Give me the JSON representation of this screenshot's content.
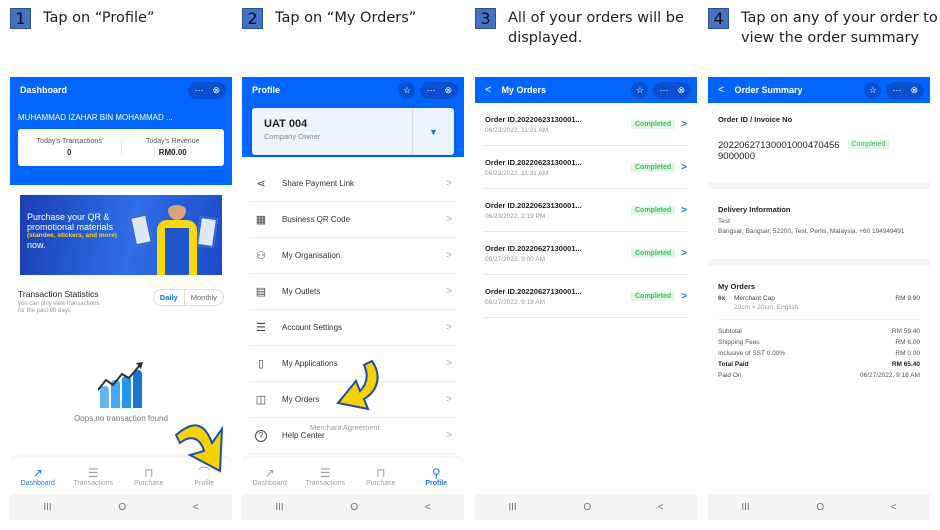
{
  "steps": [
    {
      "num": "1",
      "text": "Tap on “Profile”"
    },
    {
      "num": "2",
      "text": "Tap on “My Orders”"
    },
    {
      "num": "3",
      "text": "All of your orders will be displayed."
    },
    {
      "num": "4",
      "text": "Tap on any of your order to view the order summary"
    }
  ],
  "common": {
    "more_icon": "⋯",
    "close_icon": "⊗",
    "star_icon": "☆",
    "back_icon": "<",
    "chevron_icon": ">",
    "sys_recent": "III",
    "sys_home": "O",
    "sys_back": "<"
  },
  "colors": {
    "brand_blue": "#0066ff",
    "step_badge": "#4472c4",
    "completed_text": "#3bbf5f",
    "completed_bg": "#e3f8e7",
    "arrow_yellow": "#f6d300"
  },
  "bottom_nav": [
    {
      "label": "Dashboard",
      "icon": "trend-up-icon"
    },
    {
      "label": "Transactions",
      "icon": "list-icon"
    },
    {
      "label": "Purchase",
      "icon": "bag-icon"
    },
    {
      "label": "Profile",
      "icon": "person-icon"
    }
  ],
  "dashboard": {
    "title": "Dashboard",
    "user_name": "MUHAMMAD IZAHAR BIN MOHAMMAD ...",
    "transactions_label": "Today's Transactions",
    "transactions_value": "0",
    "revenue_label": "Today's Revenue",
    "revenue_value": "RM0.00",
    "banner_line1": "Purchase your QR &",
    "banner_line2": "promotional materials",
    "banner_line3": "(standee, stickers, and more)",
    "banner_line4": "now.",
    "stats_title": "Transaction Statistics",
    "stats_sub1": "you can only view transactions",
    "stats_sub2": "for the past 90 days",
    "toggle_daily": "Daily",
    "toggle_monthly": "Monthly",
    "empty_text": "Oops,no transaction found"
  },
  "profile": {
    "title": "Profile",
    "account_name": "UAT 004",
    "account_role": "Company Owner",
    "dropdown_icon": "▼",
    "menu": [
      {
        "label": "Share Payment Link",
        "icon": "share-icon",
        "glyph": "⋖"
      },
      {
        "label": "Business QR Code",
        "icon": "qr-code-icon",
        "glyph": "▦"
      },
      {
        "label": "My Organisation",
        "icon": "organisation-icon",
        "glyph": "⚇"
      },
      {
        "label": "My Outlets",
        "icon": "store-icon",
        "glyph": "▤"
      },
      {
        "label": "Account Settings",
        "icon": "sliders-icon",
        "glyph": "☰"
      },
      {
        "label": "My Applications",
        "icon": "document-icon",
        "glyph": "▯"
      },
      {
        "label": "My Orders",
        "icon": "bag-icon",
        "glyph": "◫"
      },
      {
        "label": "Help Center",
        "icon": "help-icon",
        "glyph": "?"
      }
    ],
    "ghost_text": "Merchant Agreement"
  },
  "orders": {
    "title": "My Orders",
    "items": [
      {
        "id": "Order ID.20220623130001...",
        "date": "06/23/2022, 11:21 AM",
        "status": "Completed"
      },
      {
        "id": "Order ID.20220623130001...",
        "date": "06/23/2022, 11:31 AM",
        "status": "Completed"
      },
      {
        "id": "Order ID.20220623130001...",
        "date": "06/23/2022, 2:19 PM",
        "status": "Completed"
      },
      {
        "id": "Order ID.20220627130001...",
        "date": "06/27/2022, 9:00 AM",
        "status": "Completed"
      },
      {
        "id": "Order ID.20220627130001...",
        "date": "06/27/2022, 9:18 AM",
        "status": "Completed"
      }
    ]
  },
  "summary": {
    "title": "Order Summary",
    "id_label": "Order ID / Invoice No",
    "id_line1": "2022062713000100047045​6",
    "id_line2": "9000000",
    "status": "Completed",
    "delivery_label": "Delivery Information",
    "delivery_name": "Test",
    "delivery_address": "Bangsar, Bangsar, 52200, Test, Perlis, Malaysia. +60 194949491",
    "orders_label": "My Orders",
    "item_qty": "6x",
    "item_name": "Merchant Cap",
    "item_variant": "20cm × 20cm,  English",
    "item_price": "RM 9.90",
    "lines": [
      {
        "label": "Subtotal",
        "value": "RM 59.40",
        "bold": false
      },
      {
        "label": "Shipping Fees",
        "value": "RM 6.00",
        "bold": false
      },
      {
        "label": "Inclusive of SST 0.00%",
        "value": "RM 0.00",
        "bold": false
      },
      {
        "label": "Total Paid",
        "value": "RM 65.40",
        "bold": true
      },
      {
        "label": "Paid On",
        "value": "06/27/2022, 9:18 AM",
        "bold": false
      }
    ]
  }
}
